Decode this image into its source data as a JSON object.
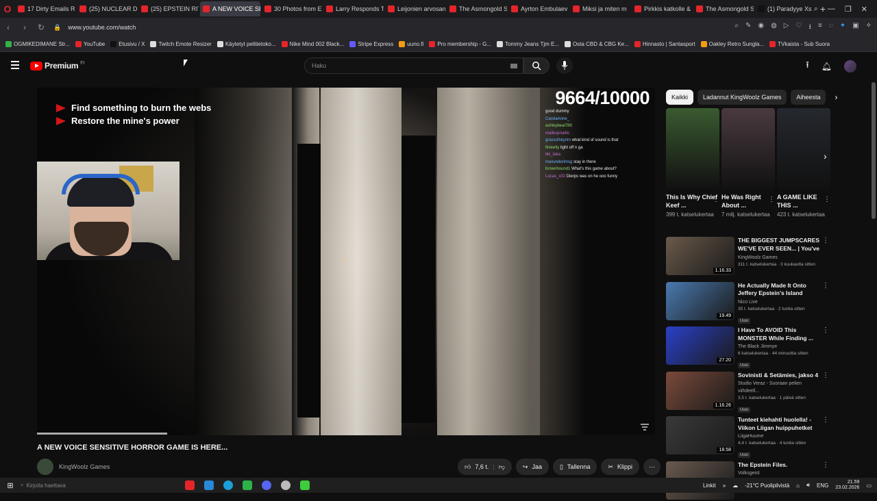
{
  "browser": {
    "tabs": [
      {
        "label": "17 Dirty Emails Re",
        "color": "#e5252a",
        "active": false
      },
      {
        "label": "(25) NUCLEAR DR",
        "color": "#e5252a",
        "active": false
      },
      {
        "label": "(25) EPSTEIN RITU",
        "color": "#e5252a",
        "active": false
      },
      {
        "label": "A NEW VOICE SENSITI",
        "color": "#e5252a",
        "active": true
      },
      {
        "label": "30 Photos from E",
        "color": "#e5252a",
        "active": false
      },
      {
        "label": "Larry Responds T",
        "color": "#e5252a",
        "active": false
      },
      {
        "label": "Leijonien arvosan",
        "color": "#e5252a",
        "active": false
      },
      {
        "label": "The Asmongold S",
        "color": "#e5252a",
        "active": false
      },
      {
        "label": "Ayrton Embulaev",
        "color": "#e5252a",
        "active": false
      },
      {
        "label": "Miksi ja miten m",
        "color": "#e5252a",
        "active": false
      },
      {
        "label": "Pirkkis katkolle &",
        "color": "#e5252a",
        "active": false
      },
      {
        "label": "The Asmongold S",
        "color": "#e5252a",
        "active": false
      },
      {
        "label": "(1) Paradyye Xs",
        "color": "#111111",
        "active": false
      }
    ],
    "url": "www.youtube.com/watch",
    "bookmarks": [
      {
        "label": "OGMIKEDIMANE Str...",
        "color": "#33b249"
      },
      {
        "label": "YouTube",
        "color": "#e5252a"
      },
      {
        "label": "Etusivu / X",
        "color": "#111111"
      },
      {
        "label": "Twitch Emote Resizer",
        "color": "#dddddd"
      },
      {
        "label": "Käytetyt pelitietoko...",
        "color": "#dddddd"
      },
      {
        "label": "Nike Mind 002 Black...",
        "color": "#e5252a"
      },
      {
        "label": "Stripe Express",
        "color": "#635bff"
      },
      {
        "label": "uuno.fi",
        "color": "#f39c12"
      },
      {
        "label": "Pro membership - G...",
        "color": "#e5252a"
      },
      {
        "label": "Tommy Jeans Tjm E...",
        "color": "#dddddd"
      },
      {
        "label": "Osta CBD & CBG Ke...",
        "color": "#dddddd"
      },
      {
        "label": "Hinnasto | Santasport",
        "color": "#e5252a"
      },
      {
        "label": "Oakley Retro Sungla...",
        "color": "#f39c12"
      },
      {
        "label": "TVkaista - Sub Suora",
        "color": "#e5252a"
      }
    ]
  },
  "youtube": {
    "logo_text": "Premium",
    "logo_region": "FI",
    "search_placeholder": "Haku"
  },
  "player": {
    "objective_1": "Find something to burn the webs",
    "objective_2": "Restore the mine's power",
    "counter": "9664/10000",
    "chat": [
      {
        "user": "",
        "msg": "good dummy"
      },
      {
        "user": "CarolaAnne_",
        "msg": ""
      },
      {
        "user": "ashleybeal789",
        "msg": ""
      },
      {
        "user": "malikspruello",
        "msg": ""
      },
      {
        "user": "grassofskyrim",
        "msg": "what kind of sound is that"
      },
      {
        "user": "finleelty",
        "msg": "light off n ga"
      },
      {
        "user": "tiki_taka",
        "msg": ""
      },
      {
        "user": "maxunderimsg",
        "msg": "stay in there"
      },
      {
        "user": "brownhound1",
        "msg": "What's this game about?"
      },
      {
        "user": "Lucas_s02",
        "msg": "Dierps was on he ooo funny"
      }
    ]
  },
  "video": {
    "title": "A NEW VOICE SENSITIVE HORROR GAME IS HERE...",
    "channel": "KingWoolz Games",
    "subs": "",
    "likes": "7,6 t.",
    "share": "Jaa",
    "save": "Tallenna",
    "clip": "Klippi"
  },
  "sidebar": {
    "chips": [
      "Kaikki",
      "Ladannut KingWoolz Games",
      "Aiheesta"
    ],
    "shorts": [
      {
        "title": "This Is Why Chief Keef ...",
        "views": "399 t. katselukertaa",
        "color": "#3a5a30"
      },
      {
        "title": "He Was Right About ...",
        "views": "7 milj. katselukertaa",
        "color": "#4a3a40"
      },
      {
        "title": "A GAME LIKE THIS ...",
        "views": "423 t. katselukertaa",
        "color": "#25282e"
      }
    ],
    "recommendations": [
      {
        "title": "THE BIGGEST JUMPSCARES WE'VE EVER SEEN... | You've ...",
        "channel": "KingWoolz Games",
        "meta": "311 t. katselukertaa · 3 kuukautta sitten",
        "duration": "1.16.33",
        "badge": "",
        "color": "#6a5a4a"
      },
      {
        "title": "He Actually Made It Onto Jeffery Epstein's Island",
        "channel": "Nico Live",
        "meta": "35 t. katselukertaa · 2 tuntia sitten",
        "duration": "19.49",
        "badge": "Uusi",
        "color": "#4a7ab0"
      },
      {
        "title": "I Have To AVOID This MONSTER While Finding ...",
        "channel": "The Black Jimmye",
        "meta": "6 katselukertaa · 44 minuuttia sitten",
        "duration": "27.20",
        "badge": "Uusi",
        "color": "#2a40c8"
      },
      {
        "title": "Sovinisti & Setämies, jakso 4",
        "channel": "Studio Veraz - Suoraan pelien viihdeell...",
        "meta": "3,5 t. katselukertaa · 1 päivä sitten",
        "duration": "1.16.26",
        "badge": "Uusi",
        "color": "#7a4a3a"
      },
      {
        "title": "Tunteet kiehahti huolella! - Viikon Liigan huippuhetket",
        "channel": "LiigaHuume",
        "meta": "4,4 t. katselukertaa · 4 tuntia sitten",
        "duration": "18.58",
        "badge": "Uusi",
        "color": "#3a3a3a"
      },
      {
        "title": "The Epstein Files.",
        "channel": "Volksgeist",
        "meta": "",
        "duration": "",
        "badge": "",
        "color": "#6a5a50"
      }
    ]
  },
  "taskbar": {
    "search_placeholder": "Kirjoita haettava",
    "links": "Linkit",
    "weather": "-21°C Puolipilvistä",
    "lang": "ENG",
    "time": "21.59",
    "date": "23.02.2026"
  }
}
